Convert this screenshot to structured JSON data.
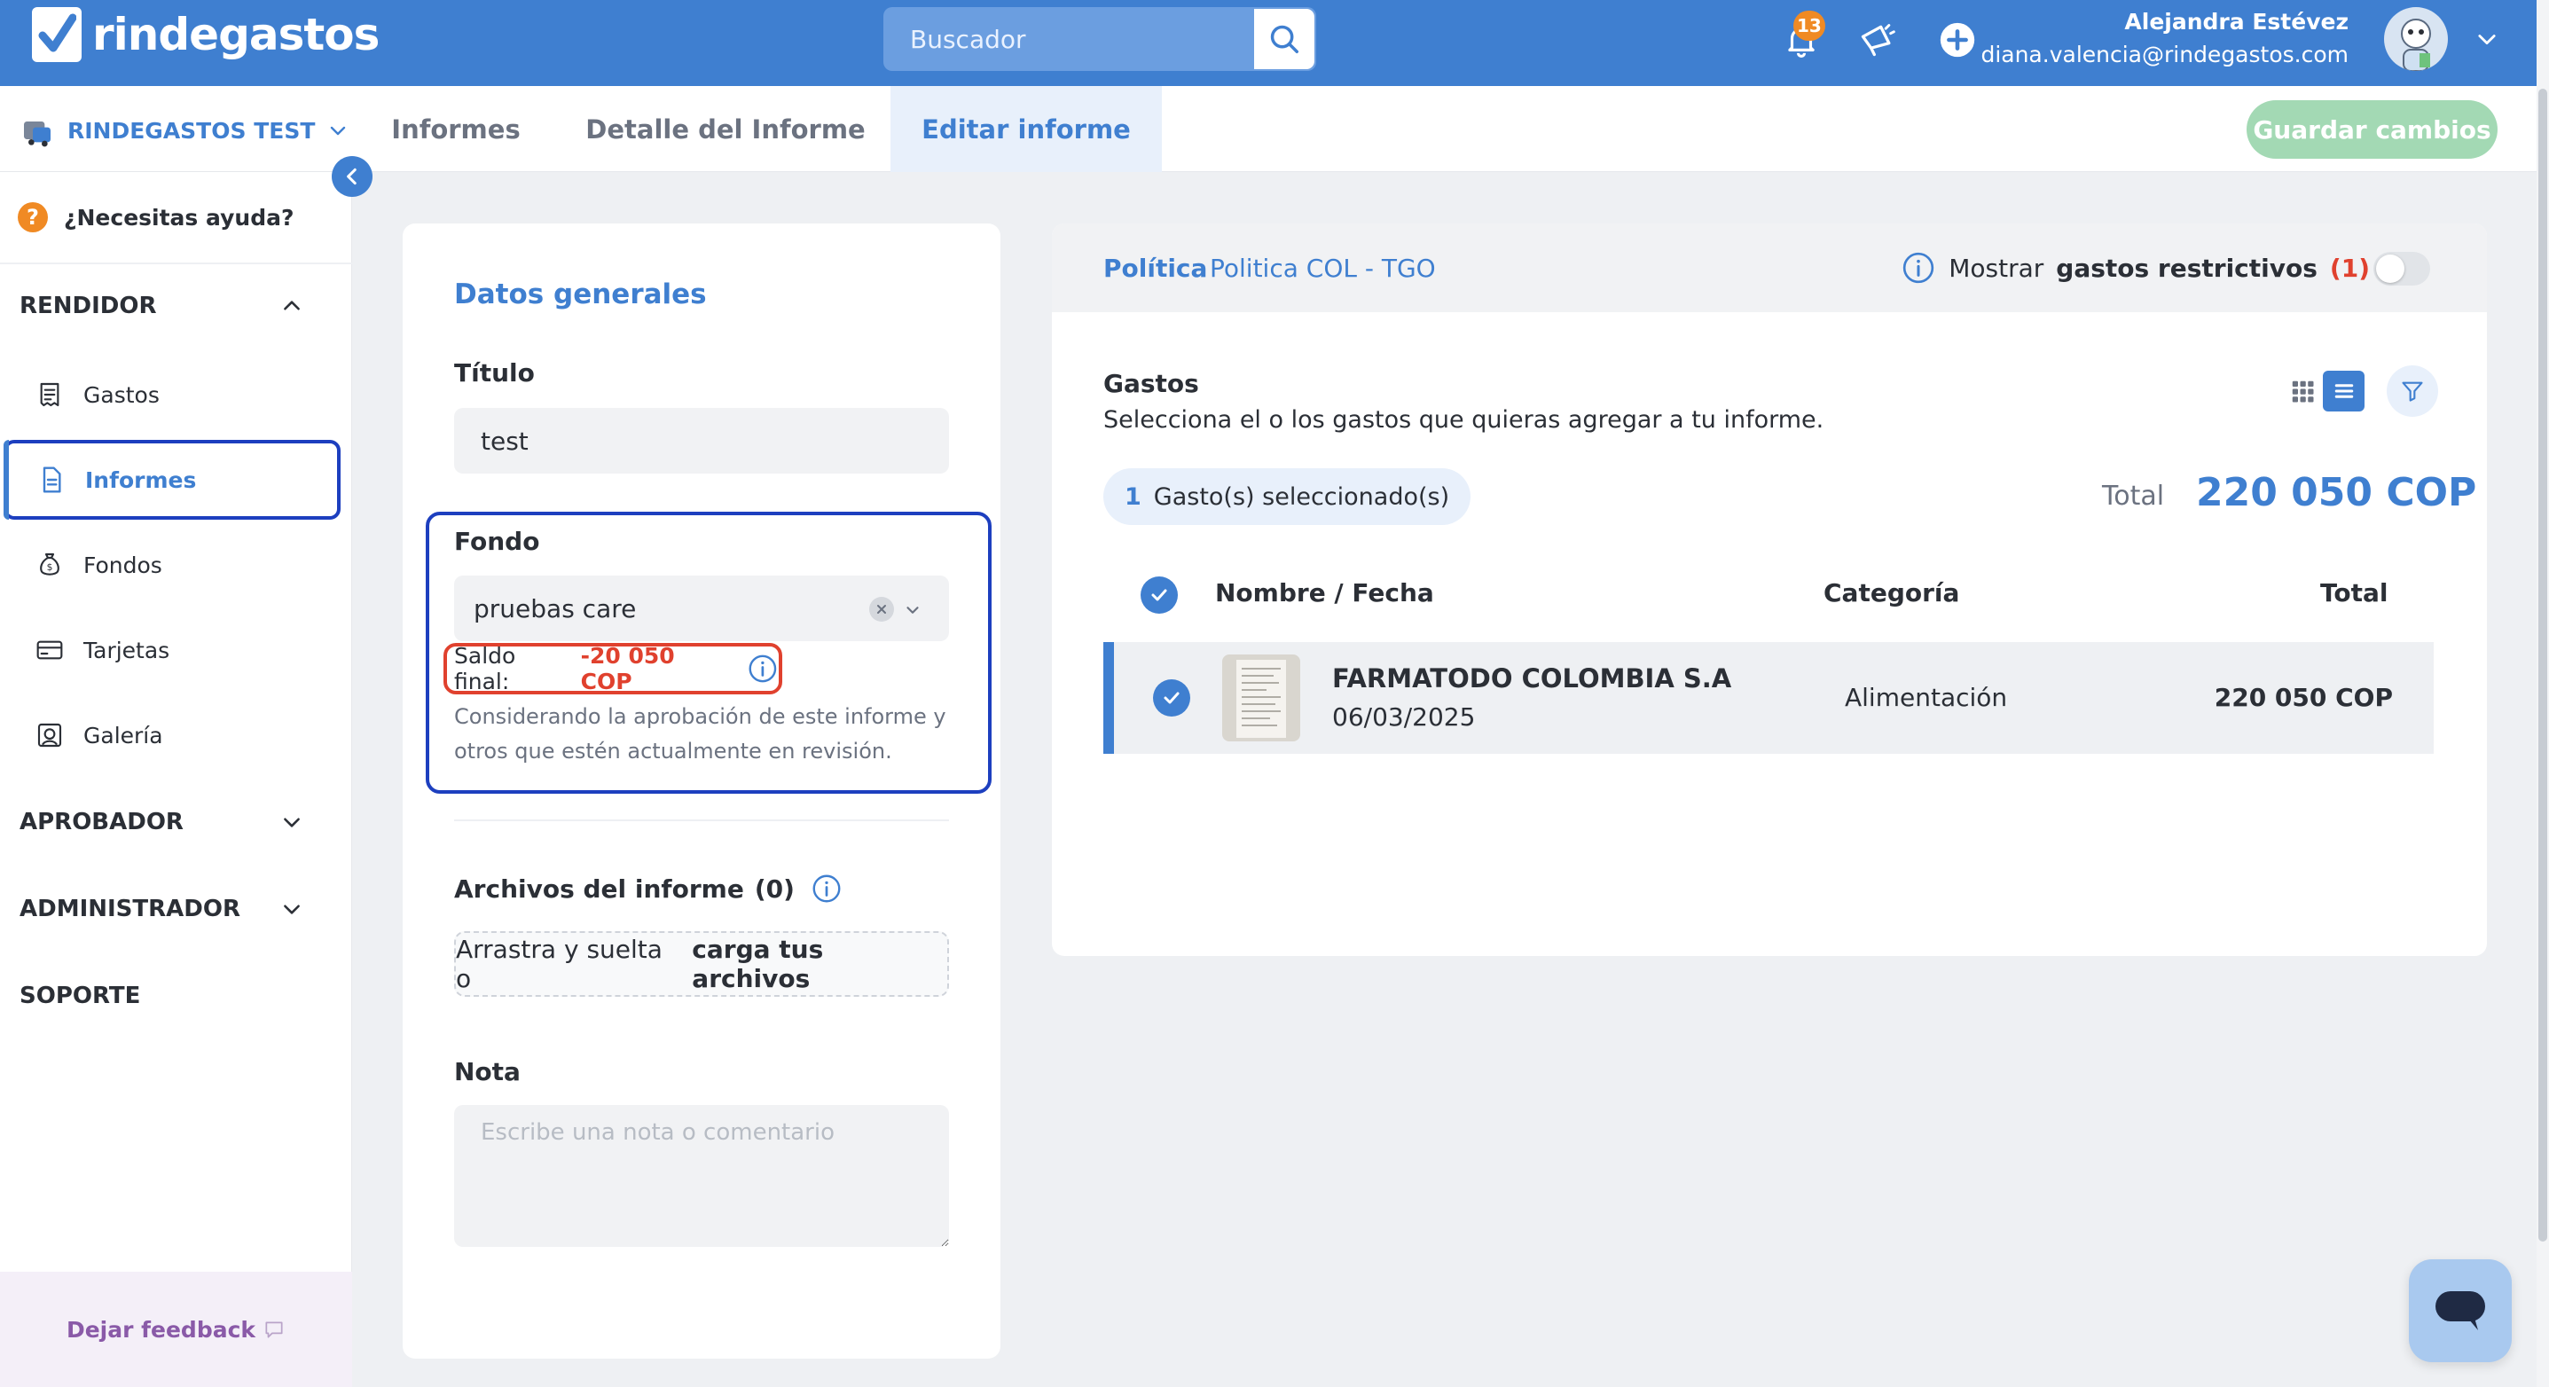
{
  "header": {
    "brand": "rindegastos",
    "search_placeholder": "Buscador",
    "notifications_count": "13",
    "user_name": "Alejandra Estévez",
    "user_email": "diana.valencia@rindegastos.com"
  },
  "subnav": {
    "org_name": "RINDEGASTOS TEST",
    "tabs": [
      {
        "label": "Informes"
      },
      {
        "label": "Detalle del Informe"
      },
      {
        "label": "Editar informe"
      }
    ],
    "save_label": "Guardar cambios"
  },
  "sidebar": {
    "help_label": "¿Necesitas ayuda?",
    "rendidor_label": "RENDIDOR",
    "items": [
      {
        "label": "Gastos"
      },
      {
        "label": "Informes"
      },
      {
        "label": "Fondos"
      },
      {
        "label": "Tarjetas"
      },
      {
        "label": "Galería"
      }
    ],
    "aprobador_label": "APROBADOR",
    "administrador_label": "ADMINISTRADOR",
    "soporte_label": "SOPORTE",
    "feedback_label": "Dejar feedback"
  },
  "general": {
    "title": "Datos generales",
    "titulo_label": "Título",
    "titulo_value": "test",
    "fondo_label": "Fondo",
    "fondo_value": "pruebas care",
    "saldo_label": "Saldo final:",
    "saldo_value": "-20 050 COP",
    "saldo_note": "Considerando la aprobación de este informe y otros que estén actualmente en revisión.",
    "archivos_label": "Archivos del informe",
    "archivos_count": "(0)",
    "upload_text": "Arrastra y suelta o",
    "upload_link": "carga tus archivos",
    "nota_label": "Nota",
    "nota_placeholder": "Escribe una nota o comentario"
  },
  "policy": {
    "label": "Política",
    "value": "Politica COL - TGO",
    "restrict_prefix": "Mostrar",
    "restrict_bold": "gastos restrictivos",
    "restrict_count": "(1)"
  },
  "gastos": {
    "title": "Gastos",
    "subtitle": "Selecciona el o los gastos que quieras agregar a tu informe.",
    "selected_count": "1",
    "selected_label": "Gasto(s) seleccionado(s)",
    "total_label": "Total",
    "total_value": "220 050 COP",
    "columns": {
      "name": "Nombre / Fecha",
      "category": "Categoría",
      "total": "Total"
    },
    "rows": [
      {
        "name": "FARMATODO COLOMBIA S.A",
        "date": "06/03/2025",
        "category": "Alimentación",
        "total": "220 050 COP"
      }
    ]
  },
  "colors": {
    "brand_blue": "#3f7fd0",
    "alert_red": "#e0412e",
    "save_green": "#a3d9b4",
    "highlight_outline": "#1d3fbf"
  }
}
